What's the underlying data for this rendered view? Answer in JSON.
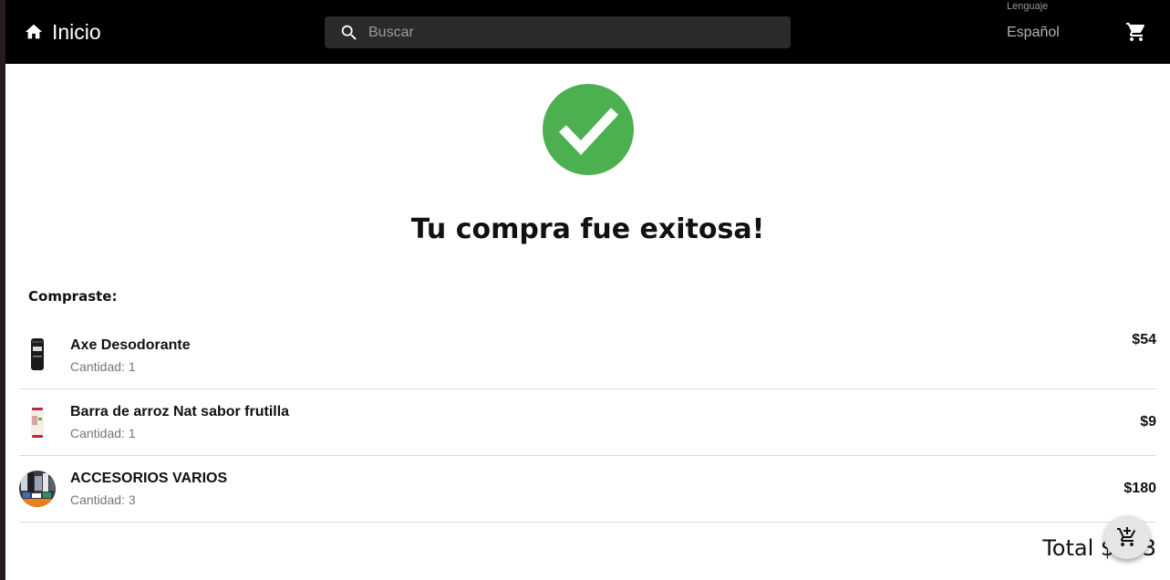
{
  "header": {
    "home_label": "Inicio",
    "search": {
      "placeholder": "Buscar",
      "value": ""
    },
    "language": {
      "caption": "Lenguaje",
      "selected": "Español"
    }
  },
  "main": {
    "title": "Tu compra fue exitosa!",
    "purchased_label": "Compraste:",
    "qty_prefix": "Cantidad: ",
    "items": [
      {
        "name": "Axe Desodorante",
        "quantity": "1",
        "price": "$54"
      },
      {
        "name": "Barra de arroz Nat sabor frutilla",
        "quantity": "1",
        "price": "$9"
      },
      {
        "name": "ACCESORIOS VARIOS",
        "quantity": "3",
        "price": "$180"
      }
    ],
    "total_label": "Total",
    "total_value": "$243"
  },
  "icons": {
    "home": "home-icon",
    "search": "search-icon",
    "cart": "shopping-cart-icon",
    "success": "check-circle-icon",
    "add_cart": "add-shopping-cart-icon"
  },
  "colors": {
    "appbar": "#000000",
    "success": "#4caf50",
    "fab": "#e6e6e6"
  }
}
